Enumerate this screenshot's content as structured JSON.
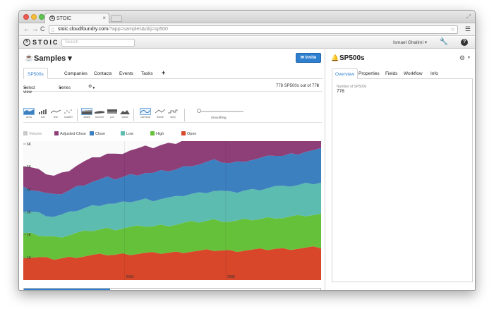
{
  "browser": {
    "tab_title": "STOIC",
    "tab_logo": "S",
    "url_domain": "stoic.cloudfoundry.com",
    "url_path": "/?app=samples&obj=sp500"
  },
  "appbar": {
    "brand": "STOIC",
    "brand_logo": "S",
    "search_placeholder": "Search",
    "user": "Ismael Ghalimi ▾"
  },
  "left": {
    "title": "Samples ▾",
    "invite_label": "✉ Invite",
    "tabs": [
      "SP500s",
      "Companies",
      "Contacts",
      "Events",
      "Tasks",
      "+"
    ],
    "select_view": "Select view",
    "series": "Series",
    "count_text": "778 SP500s out of 778",
    "plus": "+",
    "chart_types": [
      "area",
      "bar",
      "line",
      "scatter",
      "stack",
      "stream",
      "pct",
      "value",
      "cardinal",
      "linear",
      "step"
    ],
    "smoothing": "Smoothing",
    "colors": {
      "accent": "#2f7fcf"
    }
  },
  "chart_data": {
    "type": "area",
    "stacked": true,
    "legend": [
      {
        "name": "Volume",
        "color": "#c9c9c9",
        "enabled": false
      },
      {
        "name": "Adjusted Close",
        "color": "#8e3f78",
        "enabled": true
      },
      {
        "name": "Close",
        "color": "#3d80c0",
        "enabled": true
      },
      {
        "name": "Low",
        "color": "#5cbcaf",
        "enabled": true
      },
      {
        "name": "High",
        "color": "#66c13a",
        "enabled": true
      },
      {
        "name": "Open",
        "color": "#d9472b",
        "enabled": true
      }
    ],
    "yticks": [
      "1K",
      "2K",
      "3K",
      "4K",
      "5K",
      "6K"
    ],
    "xticks": [
      "2004",
      "2006"
    ],
    "ylim": [
      0,
      6000
    ],
    "x_points": 40,
    "series": [
      {
        "name": "Open",
        "values": [
          1020,
          1010,
          990,
          960,
          940,
          960,
          990,
          1030,
          1060,
          1090,
          1110,
          1130,
          1120,
          1140,
          1160,
          1170,
          1190,
          1180,
          1200,
          1210,
          1220,
          1250,
          1270,
          1280,
          1300,
          1320,
          1310,
          1290,
          1300,
          1320,
          1330,
          1340,
          1360,
          1380,
          1370,
          1390,
          1400,
          1420,
          1430,
          1440
        ]
      },
      {
        "name": "High",
        "values": [
          1040,
          1020,
          1000,
          970,
          950,
          970,
          1000,
          1040,
          1070,
          1100,
          1120,
          1140,
          1130,
          1150,
          1170,
          1180,
          1200,
          1190,
          1210,
          1220,
          1230,
          1260,
          1280,
          1290,
          1310,
          1330,
          1320,
          1300,
          1310,
          1330,
          1340,
          1350,
          1370,
          1390,
          1380,
          1400,
          1410,
          1430,
          1440,
          1450
        ]
      },
      {
        "name": "Low",
        "values": [
          1000,
          990,
          970,
          940,
          920,
          940,
          970,
          1010,
          1040,
          1070,
          1090,
          1110,
          1100,
          1120,
          1140,
          1150,
          1170,
          1160,
          1180,
          1190,
          1200,
          1230,
          1250,
          1260,
          1280,
          1300,
          1290,
          1270,
          1280,
          1300,
          1310,
          1320,
          1340,
          1360,
          1350,
          1370,
          1380,
          1400,
          1410,
          1420
        ]
      },
      {
        "name": "Close",
        "values": [
          1020,
          1000,
          980,
          950,
          930,
          950,
          990,
          1030,
          1060,
          1080,
          1100,
          1130,
          1120,
          1130,
          1160,
          1170,
          1180,
          1180,
          1200,
          1210,
          1220,
          1240,
          1270,
          1280,
          1300,
          1320,
          1300,
          1290,
          1300,
          1320,
          1330,
          1350,
          1360,
          1380,
          1370,
          1390,
          1400,
          1420,
          1430,
          1450
        ]
      },
      {
        "name": "Adjusted Close",
        "values": [
          950,
          930,
          900,
          880,
          860,
          880,
          910,
          950,
          990,
          1010,
          1030,
          1060,
          1060,
          1080,
          1100,
          1120,
          1130,
          1140,
          1160,
          1180,
          1190,
          1210,
          1240,
          1250,
          1270,
          1290,
          1280,
          1270,
          1280,
          1300,
          1310,
          1330,
          1350,
          1370,
          1360,
          1380,
          1390,
          1410,
          1420,
          1440
        ]
      }
    ]
  },
  "right": {
    "title": "SP500s",
    "tabs": [
      "Overview",
      "Properties",
      "Fields",
      "Workflow",
      "Info"
    ],
    "field_label": "Number of SP500s",
    "field_value": "778"
  },
  "progress": {
    "scroll_fraction": 0.29
  }
}
